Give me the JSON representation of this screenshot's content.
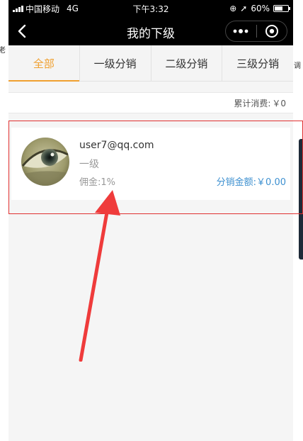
{
  "status_bar": {
    "carrier": "中国移动",
    "network": "4G",
    "time": "下午3:32",
    "battery": "60%",
    "battery_level": 0.6
  },
  "nav": {
    "title": "我的下级",
    "more_icon": "more-dots-icon",
    "close_icon": "target-circle-icon"
  },
  "tabs": [
    {
      "label": "全部",
      "active": true
    },
    {
      "label": "一级分销",
      "active": false
    },
    {
      "label": "二级分销",
      "active": false
    },
    {
      "label": "三级分销",
      "active": false
    }
  ],
  "summary": {
    "label": "累计消费:",
    "amount": "￥0"
  },
  "members": [
    {
      "email": "user7@qq.com",
      "level": "一级",
      "commission": "佣金:1%",
      "distribution": "分销金额:￥0.00"
    }
  ],
  "side_fragments": {
    "left": "老",
    "right": "调"
  },
  "colors": {
    "accent": "#f0a030",
    "link": "#3d90d0",
    "annotation": "#e03030"
  }
}
